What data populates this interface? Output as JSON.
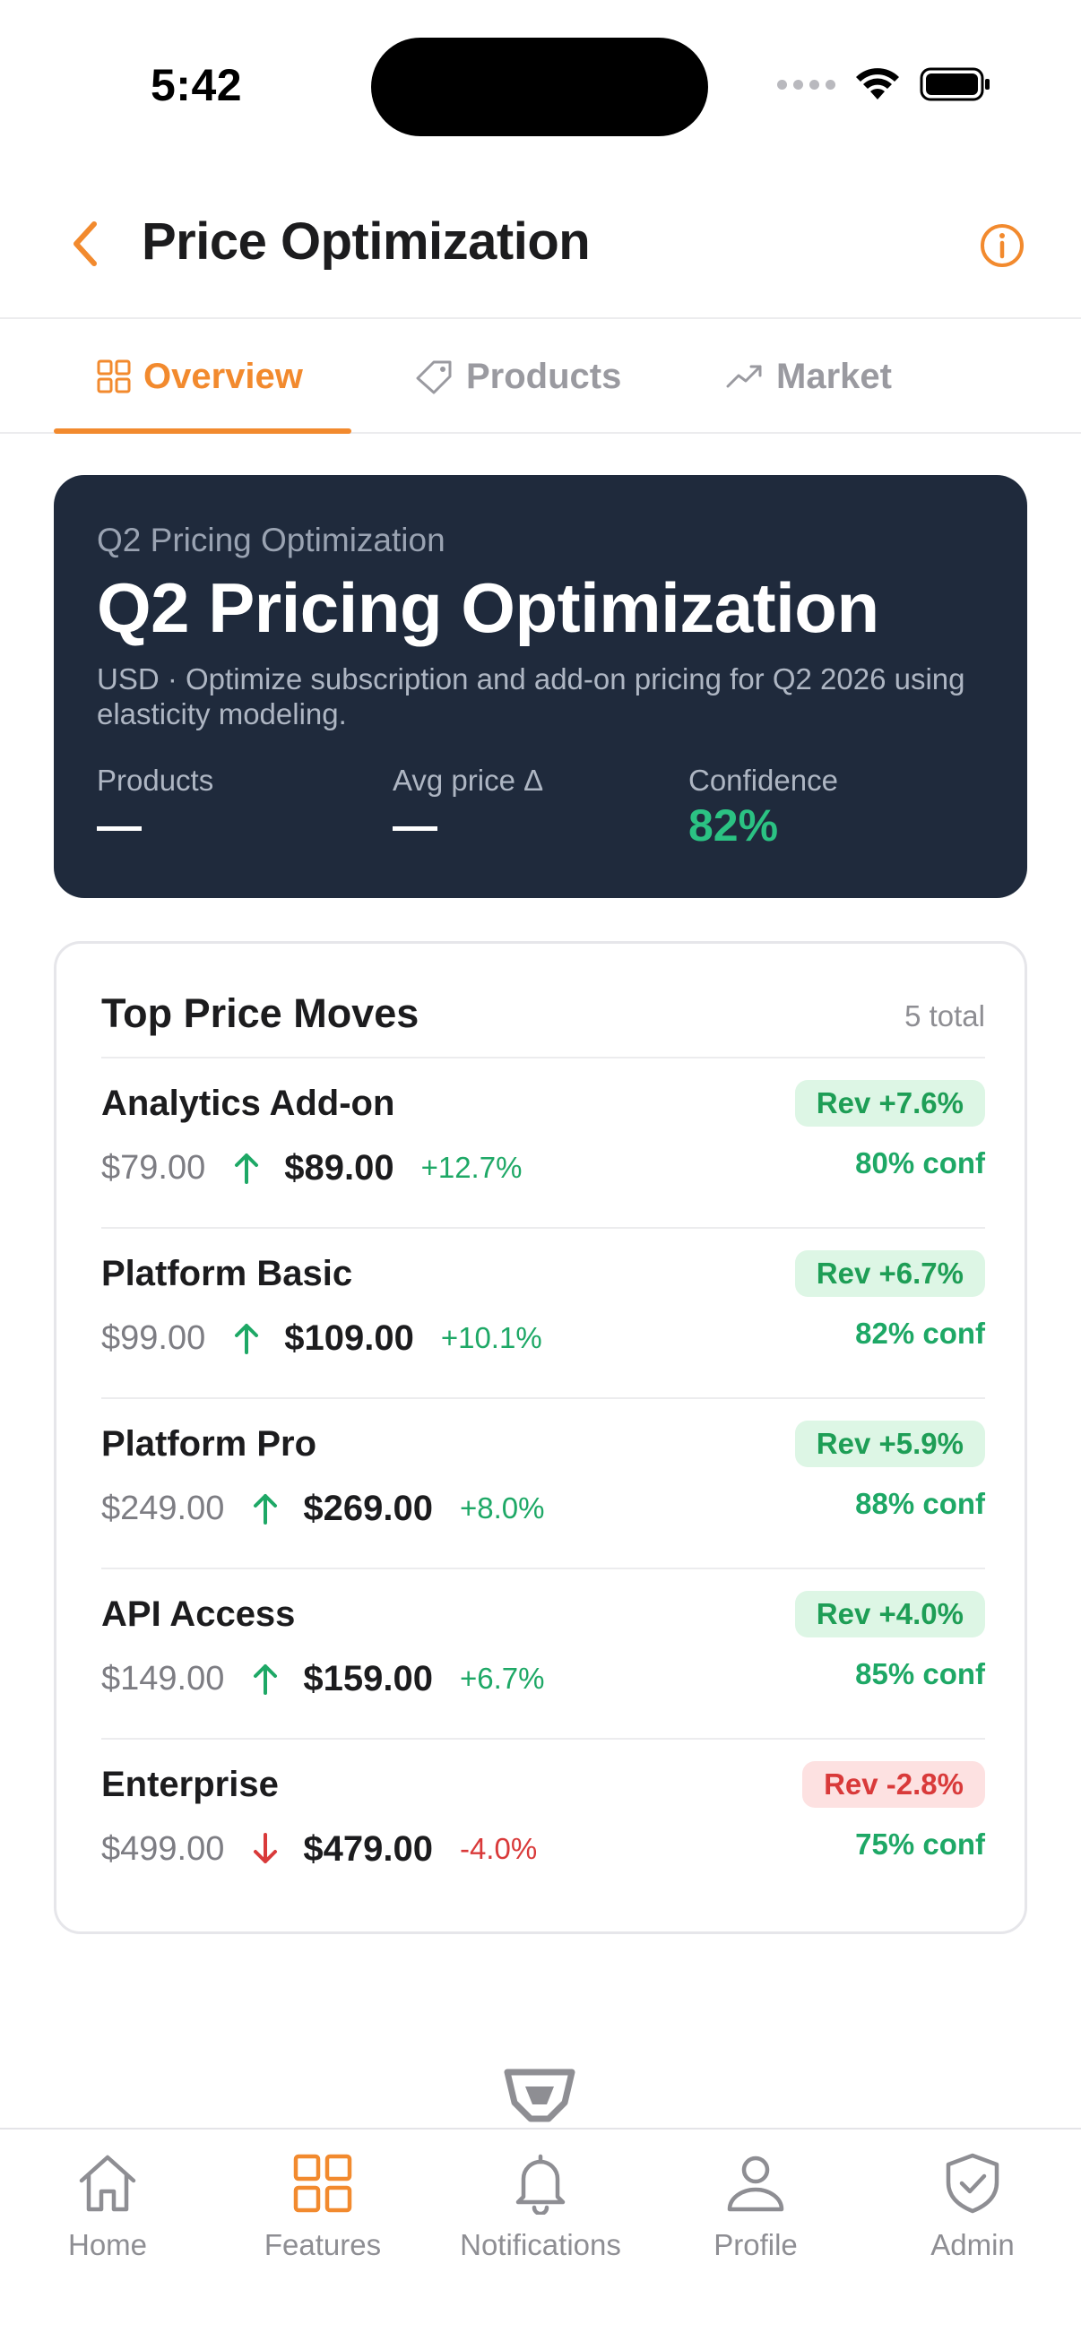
{
  "status_bar": {
    "time": "5:42"
  },
  "header": {
    "title": "Price Optimization",
    "back_icon": "chevron-left-icon",
    "info_icon": "info-icon"
  },
  "tabs": [
    {
      "label": "Overview",
      "icon": "grid-icon",
      "active": true
    },
    {
      "label": "Products",
      "icon": "tag-icon",
      "active": false
    },
    {
      "label": "Market",
      "icon": "trend-up-icon",
      "active": false
    }
  ],
  "hero": {
    "eyebrow": "Q2 Pricing Optimization",
    "title": "Q2 Pricing Optimization",
    "description": "USD · Optimize subscription and add-on pricing for Q2 2026 using elasticity modeling.",
    "stats": [
      {
        "label": "Products",
        "value": "—"
      },
      {
        "label": "Avg price Δ",
        "value": "—"
      },
      {
        "label": "Confidence",
        "value": "82%"
      }
    ]
  },
  "moves": {
    "title": "Top Price Moves",
    "total": "5 total",
    "items": [
      {
        "name": "Analytics Add-on",
        "old_price": "$79.00",
        "direction": "up",
        "new_price": "$89.00",
        "pct": "+12.7%",
        "rev": "Rev +7.6%",
        "conf": "80% conf"
      },
      {
        "name": "Platform Basic",
        "old_price": "$99.00",
        "direction": "up",
        "new_price": "$109.00",
        "pct": "+10.1%",
        "rev": "Rev +6.7%",
        "conf": "82% conf"
      },
      {
        "name": "Platform Pro",
        "old_price": "$249.00",
        "direction": "up",
        "new_price": "$269.00",
        "pct": "+8.0%",
        "rev": "Rev +5.9%",
        "conf": "88% conf"
      },
      {
        "name": "API Access",
        "old_price": "$149.00",
        "direction": "up",
        "new_price": "$159.00",
        "pct": "+6.7%",
        "rev": "Rev +4.0%",
        "conf": "85% conf"
      },
      {
        "name": "Enterprise",
        "old_price": "$499.00",
        "direction": "down",
        "new_price": "$479.00",
        "pct": "-4.0%",
        "rev": "Rev -2.8%",
        "conf": "75% conf"
      }
    ]
  },
  "bottom_nav": [
    {
      "label": "Home",
      "icon": "home-icon",
      "active": false
    },
    {
      "label": "Features",
      "icon": "grid-icon",
      "active": true
    },
    {
      "label": "Notifications",
      "icon": "bell-icon",
      "active": false
    },
    {
      "label": "Profile",
      "icon": "user-icon",
      "active": false
    },
    {
      "label": "Admin",
      "icon": "shield-check-icon",
      "active": false
    }
  ],
  "colors": {
    "accent": "#f28a2e",
    "hero_bg": "#1f2a3c",
    "positive": "#1ea866",
    "negative": "#d93a3a"
  }
}
